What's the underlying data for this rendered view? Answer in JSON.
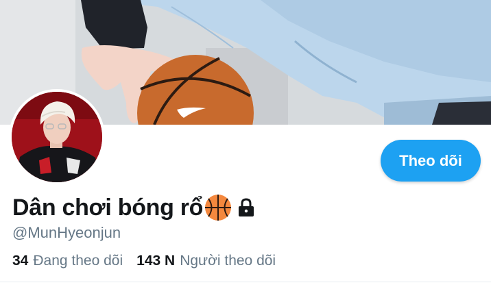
{
  "profile": {
    "display_name": "Dân chơi bóng rổ",
    "handle": "@MunHyeonjun",
    "name_emoji": "basketball-icon",
    "protected_icon": "lock-icon"
  },
  "actions": {
    "follow_label": "Theo dõi"
  },
  "stats": {
    "following_count": "34",
    "following_label": "Đang theo dõi",
    "followers_count": "143 N",
    "followers_label": "Người theo dõi"
  },
  "colors": {
    "accent": "#1da1f2",
    "text_primary": "#14171a",
    "text_secondary": "#657786"
  }
}
